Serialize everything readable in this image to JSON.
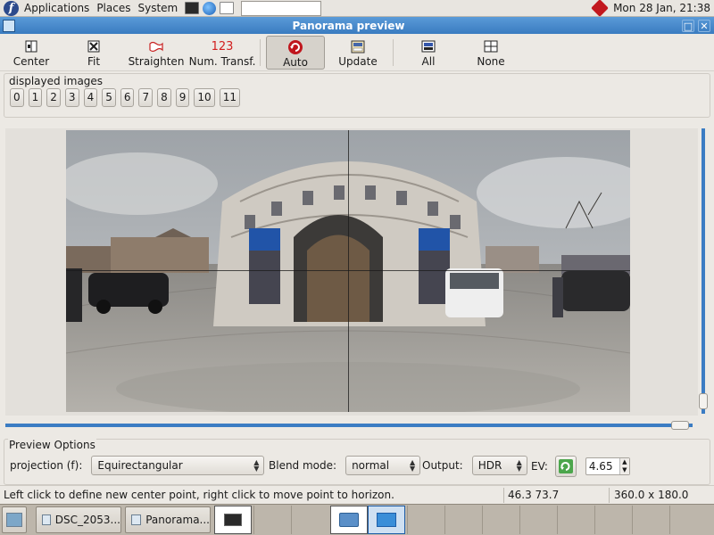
{
  "top_panel": {
    "menus": [
      "Applications",
      "Places",
      "System"
    ],
    "launchers": [
      "terminal-icon",
      "web-browser-icon",
      "dictionary-icon"
    ],
    "clock": "Mon 28 Jan, 21:38"
  },
  "window": {
    "title": "Panorama preview"
  },
  "toolbar": {
    "center": "Center",
    "fit": "Fit",
    "straighten": "Straighten",
    "num_transf": "Num. Transf.",
    "num_transf_icon_text": "123",
    "auto": "Auto",
    "update": "Update",
    "all": "All",
    "none": "None"
  },
  "displayed_images": {
    "label": "displayed images",
    "buttons": [
      "0",
      "1",
      "2",
      "3",
      "4",
      "5",
      "6",
      "7",
      "8",
      "9",
      "10",
      "11"
    ]
  },
  "preview_options": {
    "label": "Preview Options",
    "projection_label": "projection (f):",
    "projection_value": "Equirectangular",
    "blend_label": "Blend mode:",
    "blend_value": "normal",
    "output_label": "Output:",
    "output_value": "HDR",
    "ev_label": "EV:",
    "ev_value": "4.65"
  },
  "status": {
    "message": "Left click to define new center point, right click to move point to horizon.",
    "coords": "46.3 73.7",
    "fov": "360.0 x 180.0"
  },
  "taskbar": {
    "tasks": [
      "DSC_2053...",
      "Panorama..."
    ]
  },
  "colors": {
    "title_bar": "#3a7cc0",
    "scrollbar": "#3b7cc3",
    "sky": "#b9bcc0",
    "building": "#cbc7c0"
  }
}
